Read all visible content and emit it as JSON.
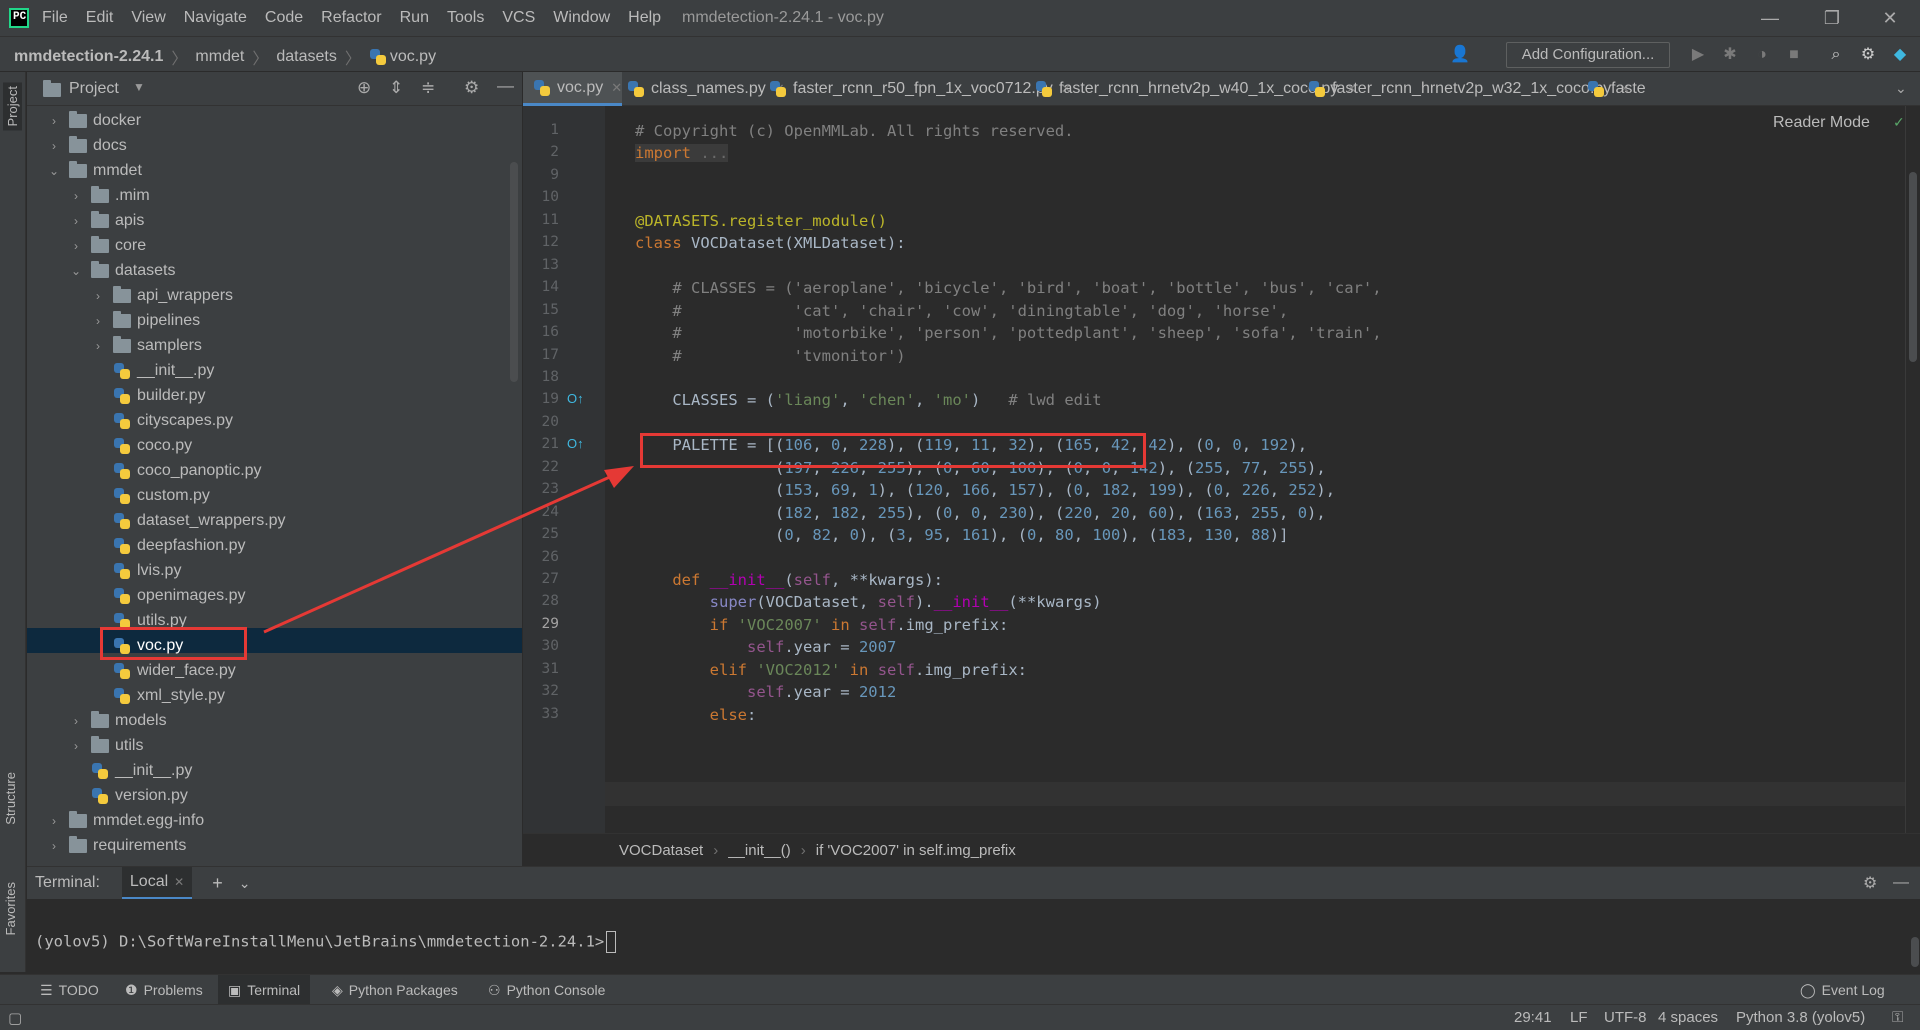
{
  "window": {
    "title": "mmdetection-2.24.1 - voc.py",
    "menu": [
      "File",
      "Edit",
      "View",
      "Navigate",
      "Code",
      "Refactor",
      "Run",
      "Tools",
      "VCS",
      "Window",
      "Help"
    ]
  },
  "navbar": {
    "breadcrumb": [
      "mmdetection-2.24.1",
      "mmdet",
      "datasets",
      "voc.py"
    ],
    "add_configuration": "Add Configuration..."
  },
  "side_tabs": {
    "project": "Project",
    "structure": "Structure",
    "favorites": "Favorites"
  },
  "project": {
    "title": "Project",
    "tree": [
      {
        "label": "docker",
        "type": "folder",
        "depth": 0,
        "arrow": "›"
      },
      {
        "label": "docs",
        "type": "folder",
        "depth": 0,
        "arrow": "›"
      },
      {
        "label": "mmdet",
        "type": "folder",
        "depth": 0,
        "arrow": "⌄"
      },
      {
        "label": ".mim",
        "type": "folder",
        "depth": 1,
        "arrow": "›"
      },
      {
        "label": "apis",
        "type": "folder",
        "depth": 1,
        "arrow": "›"
      },
      {
        "label": "core",
        "type": "folder",
        "depth": 1,
        "arrow": "›"
      },
      {
        "label": "datasets",
        "type": "folder",
        "depth": 1,
        "arrow": "⌄"
      },
      {
        "label": "api_wrappers",
        "type": "folder",
        "depth": 2,
        "arrow": "›"
      },
      {
        "label": "pipelines",
        "type": "folder",
        "depth": 2,
        "arrow": "›"
      },
      {
        "label": "samplers",
        "type": "folder",
        "depth": 2,
        "arrow": "›"
      },
      {
        "label": "__init__.py",
        "type": "py",
        "depth": 2,
        "arrow": ""
      },
      {
        "label": "builder.py",
        "type": "py",
        "depth": 2,
        "arrow": ""
      },
      {
        "label": "cityscapes.py",
        "type": "py",
        "depth": 2,
        "arrow": ""
      },
      {
        "label": "coco.py",
        "type": "py",
        "depth": 2,
        "arrow": ""
      },
      {
        "label": "coco_panoptic.py",
        "type": "py",
        "depth": 2,
        "arrow": ""
      },
      {
        "label": "custom.py",
        "type": "py",
        "depth": 2,
        "arrow": ""
      },
      {
        "label": "dataset_wrappers.py",
        "type": "py",
        "depth": 2,
        "arrow": ""
      },
      {
        "label": "deepfashion.py",
        "type": "py",
        "depth": 2,
        "arrow": ""
      },
      {
        "label": "lvis.py",
        "type": "py",
        "depth": 2,
        "arrow": ""
      },
      {
        "label": "openimages.py",
        "type": "py",
        "depth": 2,
        "arrow": ""
      },
      {
        "label": "utils.py",
        "type": "py",
        "depth": 2,
        "arrow": ""
      },
      {
        "label": "voc.py",
        "type": "py",
        "depth": 2,
        "arrow": "",
        "selected": true
      },
      {
        "label": "wider_face.py",
        "type": "py",
        "depth": 2,
        "arrow": ""
      },
      {
        "label": "xml_style.py",
        "type": "py",
        "depth": 2,
        "arrow": ""
      },
      {
        "label": "models",
        "type": "folder",
        "depth": 1,
        "arrow": "›"
      },
      {
        "label": "utils",
        "type": "folder",
        "depth": 1,
        "arrow": "›"
      },
      {
        "label": "__init__.py",
        "type": "py",
        "depth": 1,
        "arrow": ""
      },
      {
        "label": "version.py",
        "type": "py",
        "depth": 1,
        "arrow": ""
      },
      {
        "label": "mmdet.egg-info",
        "type": "folder",
        "depth": 0,
        "arrow": "›"
      },
      {
        "label": "requirements",
        "type": "folder",
        "depth": 0,
        "arrow": "›"
      }
    ]
  },
  "editor": {
    "tabs": [
      {
        "label": "voc.py",
        "active": true
      },
      {
        "label": "class_names.py"
      },
      {
        "label": "faster_rcnn_r50_fpn_1x_voc0712.py"
      },
      {
        "label": "faster_rcnn_hrnetv2p_w40_1x_coco.py"
      },
      {
        "label": "faster_rcnn_hrnetv2p_w32_1x_coco.py"
      },
      {
        "label": "faste"
      }
    ],
    "reader_mode": "Reader Mode",
    "line_numbers": [
      "1",
      "2",
      "9",
      "10",
      "11",
      "12",
      "13",
      "14",
      "15",
      "16",
      "17",
      "18",
      "19",
      "20",
      "21",
      "22",
      "23",
      "24",
      "25",
      "26",
      "27",
      "28",
      "29",
      "30",
      "31",
      "32",
      "33"
    ],
    "code": [
      "# Copyright (c) OpenMMLab. All rights reserved.",
      "import ...",
      "",
      "",
      "@DATASETS.register_module()",
      "class VOCDataset(XMLDataset):",
      "",
      "    # CLASSES = ('aeroplane', 'bicycle', 'bird', 'boat', 'bottle', 'bus', 'car',",
      "    #            'cat', 'chair', 'cow', 'diningtable', 'dog', 'horse',",
      "    #            'motorbike', 'person', 'pottedplant', 'sheep', 'sofa', 'train',",
      "    #            'tvmonitor')",
      "",
      "    CLASSES = ('liang', 'chen', 'mo')   # lwd edit",
      "",
      "    PALETTE = [(106, 0, 228), (119, 11, 32), (165, 42, 42), (0, 0, 192),",
      "               (197, 226, 255), (0, 60, 100), (0, 0, 142), (255, 77, 255),",
      "               (153, 69, 1), (120, 166, 157), (0, 182, 199), (0, 226, 252),",
      "               (182, 182, 255), (0, 0, 230), (220, 20, 60), (163, 255, 0),",
      "               (0, 82, 0), (3, 95, 161), (0, 80, 100), (183, 130, 88)]",
      "",
      "    def __init__(self, **kwargs):",
      "        super(VOCDataset, self).__init__(**kwargs)",
      "        if 'VOC2007' in self.img_prefix:",
      "            self.year = 2007",
      "        elif 'VOC2012' in self.img_prefix:",
      "            self.year = 2012",
      "        else:"
    ],
    "breadcrumb": [
      "VOCDataset",
      "__init__()",
      "if 'VOC2007' in self.img_prefix"
    ]
  },
  "terminal": {
    "label": "Terminal:",
    "tab": "Local",
    "prompt": "(yolov5) D:\\SoftWareInstallMenu\\JetBrains\\mmdetection-2.24.1>"
  },
  "toolwindows": [
    "TODO",
    "Problems",
    "Terminal",
    "Python Packages",
    "Python Console"
  ],
  "event_log": "Event Log",
  "status": {
    "position": "29:41",
    "line_sep": "LF",
    "encoding": "UTF-8",
    "indent": "4 spaces",
    "interpreter": "Python 3.8 (yolov5)"
  },
  "colors": {
    "annotation": "#e53935",
    "accent": "#4a88c7",
    "selection": "#0d293e"
  }
}
